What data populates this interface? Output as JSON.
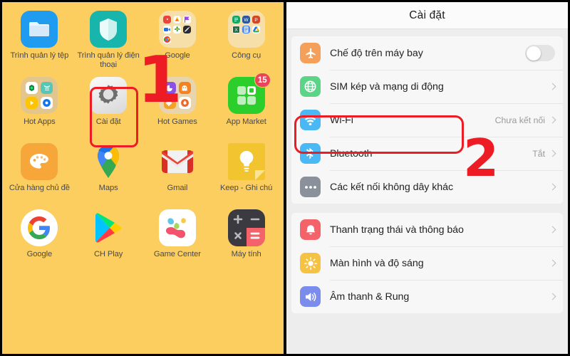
{
  "home": {
    "background_color": "#FCCD5F",
    "apps": [
      {
        "label": "Trình quản lý tệp",
        "icon": "file-manager-icon",
        "color": "#1F9BF0"
      },
      {
        "label": "Trình quản lý điện thoại",
        "icon": "phone-manager-shield-icon",
        "color": "#18B5AD"
      },
      {
        "label": "Google",
        "icon": "google-folder-icon",
        "color": "#F6DFA8"
      },
      {
        "label": "Công cụ",
        "icon": "tools-folder-icon",
        "color": "#F6DFA8"
      },
      {
        "label": "Hot Apps",
        "icon": "hot-apps-folder-icon",
        "color": "#E2C68D"
      },
      {
        "label": "Cài đặt",
        "icon": "settings-gear-icon",
        "color": "#E8E8E8"
      },
      {
        "label": "Hot Games",
        "icon": "hot-games-folder-icon",
        "color": "#E8D5AE"
      },
      {
        "label": "App Market",
        "icon": "app-market-icon",
        "color": "#2BCE2B",
        "badge": "15"
      },
      {
        "label": "Cửa hàng chủ đề",
        "icon": "theme-store-palette-icon",
        "color": "#F7A639"
      },
      {
        "label": "Maps",
        "icon": "google-maps-pin-icon",
        "color": "transparent"
      },
      {
        "label": "Gmail",
        "icon": "gmail-envelope-icon",
        "color": "transparent"
      },
      {
        "label": "Keep - Ghi chú",
        "icon": "google-keep-bulb-icon",
        "color": "#F2C430"
      },
      {
        "label": "Google",
        "icon": "google-g-icon",
        "color": "#FFFFFF"
      },
      {
        "label": "CH Play",
        "icon": "play-store-icon",
        "color": "transparent"
      },
      {
        "label": "Game Center",
        "icon": "game-center-icon",
        "color": "#FFFFFF"
      },
      {
        "label": "Máy tính",
        "icon": "calculator-icon",
        "color": "#3A3A40"
      }
    ],
    "annotation": {
      "label": "1",
      "color": "#ED1C24",
      "highlights": "cai-dat-app"
    }
  },
  "settings": {
    "header": {
      "title": "Cài đặt"
    },
    "annotation": {
      "label": "2",
      "color": "#ED1C24",
      "highlights": "wifi-row"
    },
    "groups": [
      {
        "rows": [
          {
            "label": "Chế độ trên máy bay",
            "icon": "airplane-icon",
            "icon_color": "#F5A05A",
            "control": "toggle",
            "toggle_on": false
          },
          {
            "label": "SIM kép và mạng di động",
            "icon": "globe-sim-icon",
            "icon_color": "#5BD488",
            "control": "chevron",
            "value": ""
          },
          {
            "label": "Wi-Fi",
            "icon": "wifi-icon",
            "icon_color": "#4AB8F5",
            "control": "chevron",
            "value": "Chưa kết nối"
          },
          {
            "label": "Bluetooth",
            "icon": "bluetooth-icon",
            "icon_color": "#4AB8F5",
            "control": "chevron",
            "value": "Tắt"
          },
          {
            "label": "Các kết nối không dây khác",
            "icon": "ellipsis-icon",
            "icon_color": "#8B919B",
            "control": "chevron",
            "value": ""
          }
        ]
      },
      {
        "rows": [
          {
            "label": "Thanh trạng thái và thông báo",
            "icon": "bell-icon",
            "icon_color": "#F4626A",
            "control": "chevron",
            "value": ""
          },
          {
            "label": "Màn hình và độ sáng",
            "icon": "brightness-icon",
            "icon_color": "#F5C242",
            "control": "chevron",
            "value": ""
          },
          {
            "label": "Âm thanh & Rung",
            "icon": "speaker-icon",
            "icon_color": "#7A8CEC",
            "control": "chevron",
            "value": ""
          }
        ]
      }
    ]
  }
}
